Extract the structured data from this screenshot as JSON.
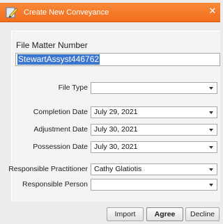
{
  "window": {
    "title": "Create New Conveyance",
    "close_glyph": "✕",
    "app_icon": "document-pencil-icon"
  },
  "form": {
    "file_matter_label": "File Matter Number",
    "file_matter_value": "StewartAssyst446762",
    "fields": [
      {
        "label": "File Type",
        "value": ""
      },
      {
        "label": "Completion Date",
        "value": "July 29, 2021"
      },
      {
        "label": "Adjustment Date",
        "value": "July 30, 2021"
      },
      {
        "label": "Possession Date",
        "value": "July 30, 2021"
      },
      {
        "label": "Responsible Practitioner",
        "value": "Cathy Glatiotis"
      },
      {
        "label": "Responsible Person",
        "value": ""
      }
    ]
  },
  "buttons": {
    "import": "Import",
    "agree": "Agree",
    "decline": "Decline"
  },
  "colors": {
    "titlebar": "#f36d1a",
    "selection": "#3a75d0"
  }
}
